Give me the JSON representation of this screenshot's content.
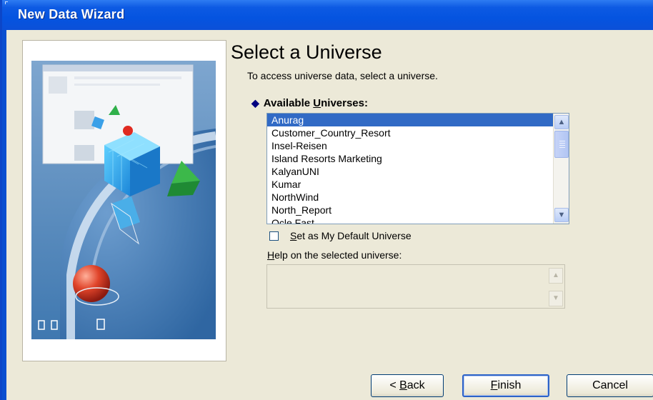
{
  "window": {
    "title": "New Data Wizard"
  },
  "page": {
    "heading": "Select a Universe",
    "subtitle": "To access universe data, select a universe."
  },
  "universes": {
    "label_pre": "Available ",
    "label_accel": "U",
    "label_post": "niverses:",
    "items": [
      "Anurag",
      "Customer_Country_Resort",
      "Insel-Reisen",
      "Island Resorts Marketing",
      "KalyanUNI",
      "Kumar",
      "NorthWind",
      "North_Report",
      "Ocle Fast"
    ],
    "selected": "Anurag"
  },
  "default_checkbox": {
    "accel": "S",
    "label_rest": "et as My Default Universe",
    "checked": false
  },
  "help": {
    "accel": "H",
    "label_rest": "elp on the selected universe:",
    "text": ""
  },
  "buttons": {
    "back_pre": "< ",
    "back_accel": "B",
    "back_rest": "ack",
    "finish_accel": "F",
    "finish_rest": "inish",
    "cancel": "Cancel"
  },
  "colors": {
    "titlebar": "#0554e0",
    "selection": "#316ac5",
    "dialog_bg": "#ece9d8"
  },
  "icons": {
    "list_up": "scroll-up-arrow",
    "list_down": "scroll-down-arrow",
    "label_marker": "diamond"
  }
}
